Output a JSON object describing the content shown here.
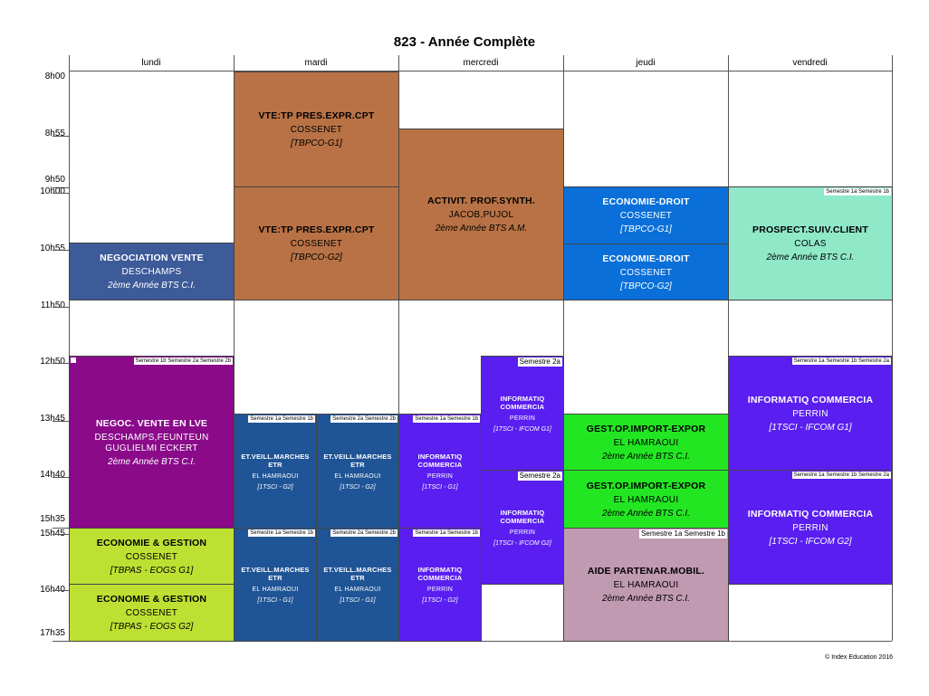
{
  "title": "823 - Année Complète",
  "days": [
    "lundi",
    "mardi",
    "mercredi",
    "jeudi",
    "vendredi"
  ],
  "times": [
    "8h00",
    "8h55",
    "9h50",
    "10h00",
    "10h55",
    "11h50",
    "12h50",
    "13h45",
    "14h40",
    "15h35",
    "15h45",
    "16h40",
    "17h35"
  ],
  "footer": "© Index Education 2016",
  "courses": {
    "lun1": {
      "l1": "NEGOCIATION VENTE",
      "l2": "DESCHAMPS",
      "l3": "2ème Année BTS C.I."
    },
    "lun2": {
      "l1": "NEGOC. VENTE EN LVE",
      "l2a": "DESCHAMPS,FEUNTEUN",
      "l2": "GUGLIELMI ECKERT",
      "l3": "2ème Année BTS C.I.",
      "tag": "Semestre 1b Semestre 2a Semestre 2b"
    },
    "lun3": {
      "l1": "ECONOMIE & GESTION",
      "l2": "COSSENET",
      "l3": "[TBPAS - EOGS G1]"
    },
    "lun4": {
      "l1": "ECONOMIE & GESTION",
      "l2": "COSSENET",
      "l3": "[TBPAS - EOGS G2]"
    },
    "mar1": {
      "l1": "VTE:TP PRES.EXPR.CPT",
      "l2": "COSSENET",
      "l3": "[TBPCO-G1]"
    },
    "mar2": {
      "l1": "VTE:TP PRES.EXPR.CPT",
      "l2": "COSSENET",
      "l3": "[TBPCO-G2]"
    },
    "mar3": {
      "l1": "ET.VEILL.MARCHES ETR",
      "l2": "EL HAMRAOUI",
      "l3": "[1TSCI - G2]",
      "tag": "Semestre 1a Semestre 1b"
    },
    "mar4": {
      "l1": "ET.VEILL.MARCHES ETR",
      "l2": "EL HAMRAOUI",
      "l3": "[1TSCI - G2]",
      "tag": "Semestre 2a Semestre 2b"
    },
    "mar5": {
      "l1": "ET.VEILL.MARCHES ETR",
      "l2": "EL HAMRAOUI",
      "l3": "[1TSCI - G1]",
      "tag": "Semestre 1a Semestre 1b"
    },
    "mar6": {
      "l1": "ET.VEILL.MARCHES ETR",
      "l2": "EL HAMRAOUI",
      "l3": "[1TSCI - G1]",
      "tag": "Semestre 2a Semestre 2b"
    },
    "mer1": {
      "l1": "ACTIVIT. PROF.SYNTH.",
      "l2": "JACOB,PUJOL",
      "l3": "2ème Année BTS A.M."
    },
    "mer2": {
      "l1": "INFORMATIQ COMMERCIA",
      "l2": "PERRIN",
      "l3": "[1TSCI - G1]",
      "tag": "Semestre 1a Semestre 1b"
    },
    "mer3": {
      "l1": "INFORMATIQ COMMERCIA",
      "l2": "PERRIN",
      "l3": "[1TSCI - IFCOM G1]",
      "tag": "Semestre 2a"
    },
    "mer4": {
      "l1": "INFORMATIQ COMMERCIA",
      "l2": "PERRIN",
      "l3": "[1TSCI - IFCOM G2]",
      "tag": "Semestre 2a"
    },
    "mer5": {
      "l1": "INFORMATIQ COMMERCIA",
      "l2": "PERRIN",
      "l3": "[1TSCI - G2]",
      "tag": "Semestre 1a Semestre 1b"
    },
    "jeu1": {
      "l1": "ECONOMIE-DROIT",
      "l2": "COSSENET",
      "l3": "[TBPCO-G1]"
    },
    "jeu2": {
      "l1": "ECONOMIE-DROIT",
      "l2": "COSSENET",
      "l3": "[TBPCO-G2]"
    },
    "jeu3": {
      "l1": "GEST.OP.IMPORT-EXPOR",
      "l2": "EL HAMRAOUI",
      "l3": "2ème Année BTS C.I."
    },
    "jeu4": {
      "l1": "GEST.OP.IMPORT-EXPOR",
      "l2": "EL HAMRAOUI",
      "l3": "2ème Année BTS C.I."
    },
    "jeu5": {
      "l1": "AIDE PARTENAR.MOBIL.",
      "l2": "EL HAMRAOUI",
      "l3": "2ème Année BTS C.I.",
      "tag": "Semestre 1a Semestre 1b"
    },
    "ven1": {
      "l1": "PROSPECT.SUIV.CLIENT",
      "l2": "COLAS",
      "l3": "2ème Année BTS C.I.",
      "tag": "Semestre 1a Semestre 1b"
    },
    "ven2": {
      "l1": "INFORMATIQ COMMERCIA",
      "l2": "PERRIN",
      "l3": "[1TSCI - IFCOM G1]",
      "tag": "Semestre 1a Semestre 1b Semestre 2a"
    },
    "ven3": {
      "l1": "INFORMATIQ COMMERCIA",
      "l2": "PERRIN",
      "l3": "[1TSCI - IFCOM G2]",
      "tag": "Semestre 1a Semestre 1b Semestre 2a"
    }
  },
  "colors": {
    "brown": "#b87245",
    "blue_nego": "#3d5a99",
    "purple_nego": "#8a0a8a",
    "lime": "#bde032",
    "navy_veille": "#1f5496",
    "violet": "#5a1ff0",
    "azure": "#0a6fd8",
    "green": "#22e622",
    "mauve": "#c09ab0",
    "mint": "#8fe8c8"
  }
}
